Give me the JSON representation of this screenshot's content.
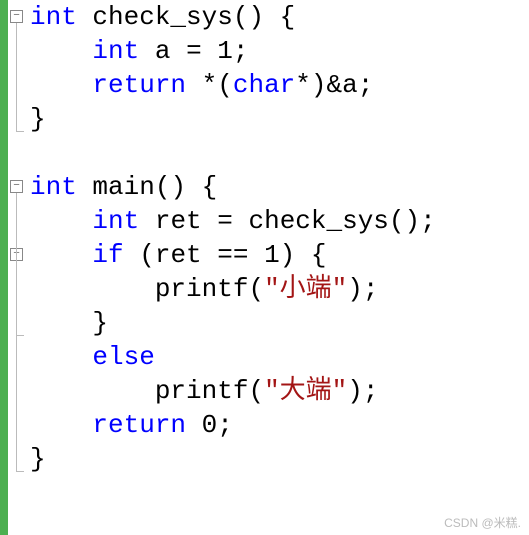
{
  "code": {
    "lines": [
      {
        "segments": [
          {
            "t": "int ",
            "c": "kw"
          },
          {
            "t": "check_sys",
            "c": "ident"
          },
          {
            "t": "() {",
            "c": "op"
          }
        ]
      },
      {
        "segments": [
          {
            "t": "    ",
            "c": "txt"
          },
          {
            "t": "int ",
            "c": "kw"
          },
          {
            "t": "a ",
            "c": "ident"
          },
          {
            "t": "= ",
            "c": "op"
          },
          {
            "t": "1",
            "c": "num"
          },
          {
            "t": ";",
            "c": "op"
          }
        ]
      },
      {
        "segments": [
          {
            "t": "    ",
            "c": "txt"
          },
          {
            "t": "return ",
            "c": "kw"
          },
          {
            "t": "*(",
            "c": "op"
          },
          {
            "t": "char",
            "c": "kw"
          },
          {
            "t": "*)&a;",
            "c": "op"
          }
        ]
      },
      {
        "segments": [
          {
            "t": "}",
            "c": "op"
          }
        ]
      },
      {
        "segments": []
      },
      {
        "segments": [
          {
            "t": "int ",
            "c": "kw"
          },
          {
            "t": "main",
            "c": "ident"
          },
          {
            "t": "() {",
            "c": "op"
          }
        ]
      },
      {
        "segments": [
          {
            "t": "    ",
            "c": "txt"
          },
          {
            "t": "int ",
            "c": "kw"
          },
          {
            "t": "ret ",
            "c": "ident"
          },
          {
            "t": "= ",
            "c": "op"
          },
          {
            "t": "check_sys",
            "c": "ident"
          },
          {
            "t": "();",
            "c": "op"
          }
        ]
      },
      {
        "segments": [
          {
            "t": "    ",
            "c": "txt"
          },
          {
            "t": "if ",
            "c": "kw"
          },
          {
            "t": "(ret == ",
            "c": "op"
          },
          {
            "t": "1",
            "c": "num"
          },
          {
            "t": ") {",
            "c": "op"
          }
        ]
      },
      {
        "segments": [
          {
            "t": "        ",
            "c": "txt"
          },
          {
            "t": "printf",
            "c": "ident"
          },
          {
            "t": "(",
            "c": "op"
          },
          {
            "t": "\"小端\"",
            "c": "str"
          },
          {
            "t": ");",
            "c": "op"
          }
        ]
      },
      {
        "segments": [
          {
            "t": "    }",
            "c": "op"
          }
        ]
      },
      {
        "segments": [
          {
            "t": "    ",
            "c": "txt"
          },
          {
            "t": "else",
            "c": "kw"
          }
        ]
      },
      {
        "segments": [
          {
            "t": "        ",
            "c": "txt"
          },
          {
            "t": "printf",
            "c": "ident"
          },
          {
            "t": "(",
            "c": "op"
          },
          {
            "t": "\"大端\"",
            "c": "str"
          },
          {
            "t": ");",
            "c": "op"
          }
        ]
      },
      {
        "segments": [
          {
            "t": "    ",
            "c": "txt"
          },
          {
            "t": "return ",
            "c": "kw"
          },
          {
            "t": "0",
            "c": "num"
          },
          {
            "t": ";",
            "c": "op"
          }
        ]
      },
      {
        "segments": [
          {
            "t": "}",
            "c": "op"
          }
        ]
      }
    ]
  },
  "fold_markers": [
    {
      "line": 0,
      "symbol": "−"
    },
    {
      "line": 5,
      "symbol": "−"
    },
    {
      "line": 7,
      "symbol": "−"
    }
  ],
  "watermark": "CSDN @米糕."
}
